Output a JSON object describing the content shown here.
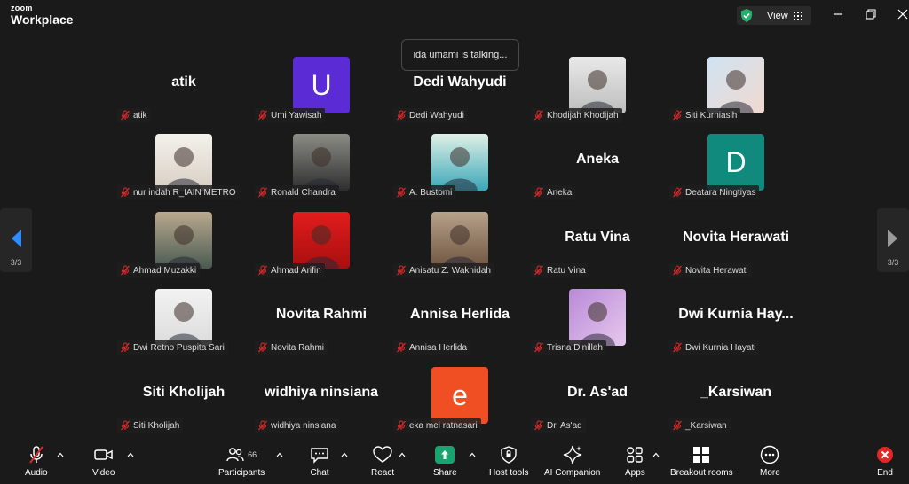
{
  "app": {
    "brand_small": "zoom",
    "brand_large": "Workplace"
  },
  "titlebar": {
    "view_label": "View"
  },
  "stage": {
    "talking_tip": "ida umami is talking...",
    "page_indicator": "3/3"
  },
  "participants": [
    {
      "id": "atik",
      "display": "name",
      "center_text": "atik",
      "label": "atik"
    },
    {
      "id": "umi",
      "display": "letter",
      "letter": "U",
      "color": "#5b2bd6",
      "label": "Umi Yawisah"
    },
    {
      "id": "dedi",
      "display": "name",
      "center_text": "Dedi Wahyudi",
      "label": "Dedi Wahyudi"
    },
    {
      "id": "khodijah",
      "display": "photo",
      "label": "Khodijah Khodijah"
    },
    {
      "id": "siti-k",
      "display": "photo",
      "label": "Siti Kurniasih"
    },
    {
      "id": "nur",
      "display": "photo",
      "label": "nur indah R_IAIN METRO"
    },
    {
      "id": "ronald",
      "display": "photo",
      "label": "Ronald Chandra"
    },
    {
      "id": "bustomi",
      "display": "photo",
      "label": "A. Bustomi"
    },
    {
      "id": "aneka",
      "display": "name",
      "center_text": "Aneka",
      "label": "Aneka"
    },
    {
      "id": "deatara",
      "display": "letter",
      "letter": "D",
      "color": "#0f8a7c",
      "label": "Deatara Ningtiyas"
    },
    {
      "id": "muzakki",
      "display": "photo",
      "label": "Ahmad Muzakki"
    },
    {
      "id": "arifin",
      "display": "photo",
      "label": "Ahmad Arifin"
    },
    {
      "id": "anisatu",
      "display": "photo",
      "label": "Anisatu Z. Wakhidah"
    },
    {
      "id": "ratu",
      "display": "name",
      "center_text": "Ratu Vina",
      "label": "Ratu Vina"
    },
    {
      "id": "novita-h",
      "display": "name",
      "center_text": "Novita Herawati",
      "label": "Novita Herawati"
    },
    {
      "id": "dwi-retno",
      "display": "photo",
      "label": "Dwi Retno Puspita Sari"
    },
    {
      "id": "novita-r",
      "display": "name",
      "center_text": "Novita Rahmi",
      "label": "Novita Rahmi"
    },
    {
      "id": "annisa",
      "display": "name",
      "center_text": "Annisa Herlida",
      "label": "Annisa Herlida"
    },
    {
      "id": "trisna",
      "display": "photo",
      "label": "Trisna Dinillah"
    },
    {
      "id": "dwi-kurnia",
      "display": "name",
      "center_text": "Dwi  Kurnia  Hay...",
      "label": "Dwi Kurnia Hayati"
    },
    {
      "id": "siti-kh",
      "display": "name",
      "center_text": "Siti Kholijah",
      "label": "Siti Kholijah"
    },
    {
      "id": "widhiya",
      "display": "name",
      "center_text": "widhiya ninsiana",
      "label": "widhiya ninsiana"
    },
    {
      "id": "eka",
      "display": "letter",
      "letter": "e",
      "color": "#f04e23",
      "label": "eka mei ratnasari"
    },
    {
      "id": "asad",
      "display": "name",
      "center_text": "Dr. As'ad",
      "label": "Dr. As'ad"
    },
    {
      "id": "karsiwan",
      "display": "name",
      "center_text": "_Karsiwan",
      "label": "_Karsiwan"
    }
  ],
  "toolbar": {
    "audio": "Audio",
    "video": "Video",
    "participants": "Participants",
    "participants_count": "66",
    "chat": "Chat",
    "react": "React",
    "share": "Share",
    "host_tools": "Host tools",
    "ai_companion": "AI Companion",
    "apps": "Apps",
    "breakout_rooms": "Breakout rooms",
    "more": "More",
    "end": "End"
  },
  "colors": {
    "share_green": "#1aa36e",
    "end_red": "#e02828",
    "muted_red": "#e02828"
  }
}
